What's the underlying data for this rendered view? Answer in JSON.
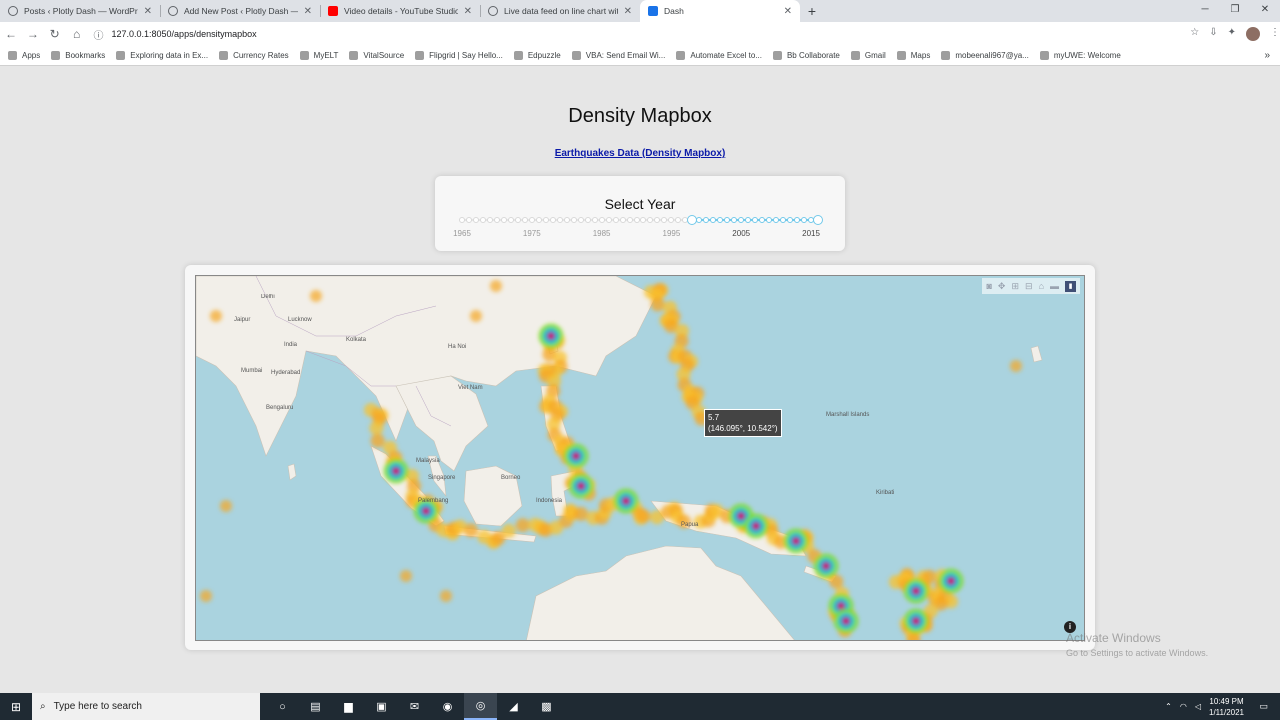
{
  "browser": {
    "tabs": [
      {
        "title": "Posts ‹ Plotly Dash — WordPress",
        "icon": "globe-icon",
        "active": false
      },
      {
        "title": "Add New Post ‹ Plotly Dash — W",
        "icon": "globe-icon",
        "active": false
      },
      {
        "title": "Video details - YouTube Studio",
        "icon": "youtube-icon",
        "active": false
      },
      {
        "title": "Live data feed on line chart with",
        "icon": "globe-icon",
        "active": false
      },
      {
        "title": "Dash",
        "icon": "dash-icon",
        "active": true
      }
    ],
    "new_tab": "+",
    "url": "127.0.0.1:8050/apps/densitymapbox",
    "bookmarks": [
      "Apps",
      "Bookmarks",
      "Exploring data in Ex...",
      "Currency Rates",
      "MyELT",
      "VitalSource",
      "Flipgrid | Say Hello...",
      "Edpuzzle",
      "VBA: Send Email Wi...",
      "Automate Excel to...",
      "Bb Collaborate",
      "Gmail",
      "Maps",
      "mobeenali967@ya...",
      "myUWE: Welcome"
    ]
  },
  "page": {
    "title": "Density Mapbox",
    "link": "Earthquakes Data (Density Mapbox)",
    "slider": {
      "label": "Select Year",
      "ticks": [
        "1965",
        "1975",
        "1985",
        "1995",
        "2005",
        "2015"
      ],
      "min": 1965,
      "max": 2016,
      "selected_range": [
        1998,
        2016
      ]
    },
    "map": {
      "hover_value": "5.7",
      "hover_coords": "(146.095°, 10.542°)",
      "place_labels": [
        "Delhi",
        "Jaipur",
        "Lucknow",
        "India",
        "Mumbai",
        "Hyderabad",
        "Bengaluru",
        "Kolkata",
        "Singapore",
        "Malaysia",
        "Palembang",
        "Indonesia",
        "Borneo",
        "Papua",
        "Ha Noi",
        "Viet Nam",
        "Marshall Islands",
        "Kiribati"
      ],
      "modebar_icons": [
        "camera-icon",
        "pan-icon",
        "zoom-in-icon",
        "zoom-out-icon",
        "home-icon",
        "reset-icon",
        "plotly-logo-icon"
      ],
      "attribution": "i"
    },
    "watermark": {
      "line1": "Activate Windows",
      "line2": "Go to Settings to activate Windows."
    }
  },
  "taskbar": {
    "search_placeholder": "Type here to search",
    "time": "10:49 PM",
    "date": "1/11/2021"
  }
}
